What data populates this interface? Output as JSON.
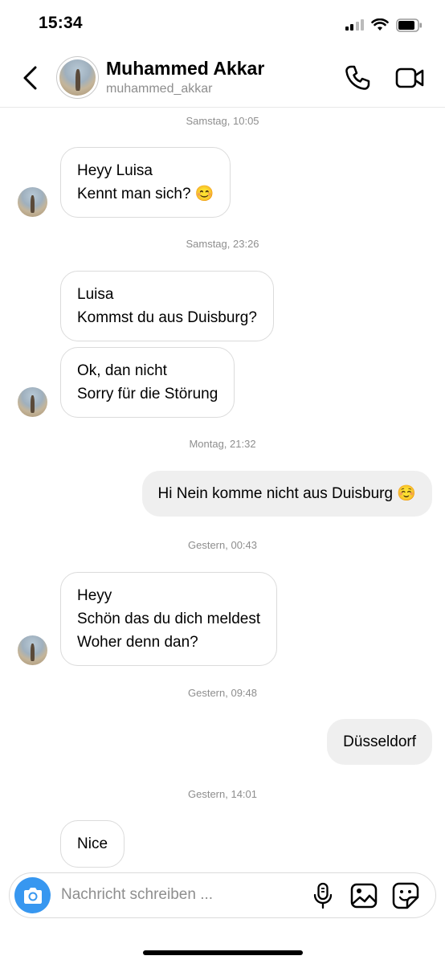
{
  "status_bar": {
    "time": "15:34"
  },
  "header": {
    "name": "Muhammed Akkar",
    "handle": "muhammed_akkar",
    "icons": {
      "back": "chevron-left-icon",
      "call": "phone-icon",
      "video": "video-camera-icon"
    }
  },
  "messages": [
    {
      "type": "timestamp",
      "text": "Samstag, 10:05"
    },
    {
      "type": "incoming",
      "text": "Heyy Luisa\nKennt man sich? 😊"
    },
    {
      "type": "timestamp",
      "text": "Samstag, 23:26"
    },
    {
      "type": "incoming",
      "text": "Luisa\nKommst du aus Duisburg?"
    },
    {
      "type": "incoming",
      "text": "Ok, dan nicht\nSorry für die Störung"
    },
    {
      "type": "timestamp",
      "text": "Montag, 21:32"
    },
    {
      "type": "outgoing",
      "text": "Hi Nein komme nicht aus Duisburg ☺️"
    },
    {
      "type": "timestamp",
      "text": "Gestern, 00:43"
    },
    {
      "type": "incoming",
      "text": "Heyy\nSchön das du dich meldest\nWoher denn dan?"
    },
    {
      "type": "timestamp",
      "text": "Gestern, 09:48"
    },
    {
      "type": "outgoing",
      "text": "Düsseldorf"
    },
    {
      "type": "timestamp",
      "text": "Gestern, 14:01"
    },
    {
      "type": "incoming",
      "text": "Nice"
    }
  ],
  "composer": {
    "placeholder": "Nachricht schreiben ...",
    "icons": {
      "camera": "camera-icon",
      "mic": "microphone-icon",
      "gallery": "image-icon",
      "sticker": "sticker-icon"
    },
    "accent_color": "#3797f0"
  }
}
